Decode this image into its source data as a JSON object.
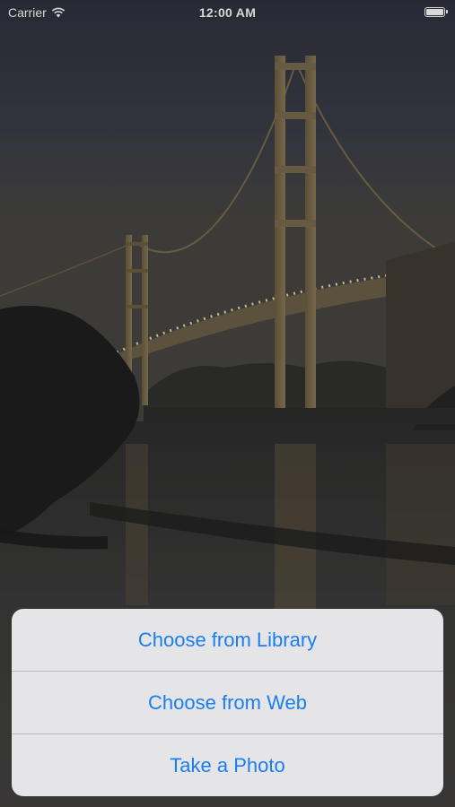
{
  "status_bar": {
    "carrier": "Carrier",
    "time": "12:00 AM",
    "wifi_icon": "wifi-icon",
    "battery_icon": "battery-icon"
  },
  "background": {
    "description_icon": "golden-gate-bridge-photo"
  },
  "action_sheet": {
    "items": [
      {
        "label": "Choose from Library"
      },
      {
        "label": "Choose from Web"
      },
      {
        "label": "Take a Photo"
      }
    ],
    "tint_color": "#1a7ef0"
  }
}
